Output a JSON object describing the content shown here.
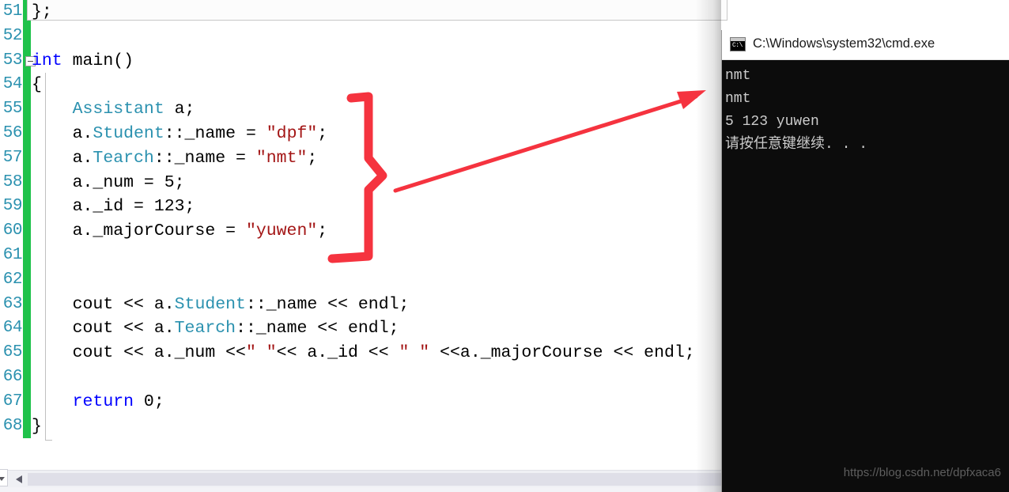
{
  "editor": {
    "name": "visual-studio-code-editor",
    "first_line_number": 51,
    "lines": [
      {
        "n": "51",
        "kind": "collapsed-end",
        "text": "};"
      },
      {
        "n": "52",
        "kind": "blank",
        "text": ""
      },
      {
        "n": "53",
        "kind": "fold",
        "text": "int main()"
      },
      {
        "n": "54",
        "kind": "code",
        "text": "{"
      },
      {
        "n": "55",
        "kind": "code",
        "text": "    Assistant a;"
      },
      {
        "n": "56",
        "kind": "code",
        "text": "    a.Student::_name = \"dpf\";"
      },
      {
        "n": "57",
        "kind": "code",
        "text": "    a.Tearch::_name = \"nmt\";"
      },
      {
        "n": "58",
        "kind": "code",
        "text": "    a._num = 5;"
      },
      {
        "n": "59",
        "kind": "code",
        "text": "    a._id = 123;"
      },
      {
        "n": "60",
        "kind": "code",
        "text": "    a._majorCourse = \"yuwen\";"
      },
      {
        "n": "61",
        "kind": "blank",
        "text": ""
      },
      {
        "n": "62",
        "kind": "blank",
        "text": ""
      },
      {
        "n": "63",
        "kind": "code",
        "text": "    cout << a.Student::_name << endl;"
      },
      {
        "n": "64",
        "kind": "code",
        "text": "    cout << a.Tearch::_name << endl;"
      },
      {
        "n": "65",
        "kind": "code",
        "text": "    cout << a._num <<\" \"<< a._id << \" \" <<a._majorCourse << endl;"
      },
      {
        "n": "66",
        "kind": "blank",
        "text": ""
      },
      {
        "n": "67",
        "kind": "code",
        "text": "    return 0;"
      },
      {
        "n": "68",
        "kind": "code",
        "text": "}"
      }
    ],
    "line_numbers": [
      "51",
      "52",
      "53",
      "54",
      "55",
      "56",
      "57",
      "58",
      "59",
      "60",
      "61",
      "62",
      "63",
      "64",
      "65",
      "66",
      "67",
      "68"
    ],
    "displayed_line_numbers": [
      "51",
      "52",
      "53",
      "54",
      "55",
      "56",
      "57",
      "58",
      "59",
      "60",
      "61",
      "62",
      "63",
      "64",
      "65",
      "66",
      "67",
      "68"
    ],
    "tokens": {
      "line51": [
        {
          "t": "};",
          "c": "plain"
        }
      ],
      "line53": [
        {
          "t": "int",
          "c": "kw"
        },
        {
          "t": " main()",
          "c": "plain"
        }
      ],
      "line54": [
        {
          "t": "{",
          "c": "plain"
        }
      ],
      "line55": [
        {
          "t": "    ",
          "c": "plain"
        },
        {
          "t": "Assistant",
          "c": "type"
        },
        {
          "t": " a;",
          "c": "plain"
        }
      ],
      "line56": [
        {
          "t": "    a.",
          "c": "plain"
        },
        {
          "t": "Student",
          "c": "type"
        },
        {
          "t": "::_name = ",
          "c": "plain"
        },
        {
          "t": "\"dpf\"",
          "c": "str"
        },
        {
          "t": ";",
          "c": "plain"
        }
      ],
      "line57": [
        {
          "t": "    a.",
          "c": "plain"
        },
        {
          "t": "Tearch",
          "c": "type"
        },
        {
          "t": "::_name = ",
          "c": "plain"
        },
        {
          "t": "\"nmt\"",
          "c": "str"
        },
        {
          "t": ";",
          "c": "plain"
        }
      ],
      "line58": [
        {
          "t": "    a._num = 5;",
          "c": "plain"
        }
      ],
      "line59": [
        {
          "t": "    a._id = 123;",
          "c": "plain"
        }
      ],
      "line60": [
        {
          "t": "    a._majorCourse = ",
          "c": "plain"
        },
        {
          "t": "\"yuwen\"",
          "c": "str"
        },
        {
          "t": ";",
          "c": "plain"
        }
      ],
      "line63": [
        {
          "t": "    cout << a.",
          "c": "plain"
        },
        {
          "t": "Student",
          "c": "type"
        },
        {
          "t": "::_name << endl;",
          "c": "plain"
        }
      ],
      "line64": [
        {
          "t": "    cout << a.",
          "c": "plain"
        },
        {
          "t": "Tearch",
          "c": "type"
        },
        {
          "t": "::_name << endl;",
          "c": "plain"
        }
      ],
      "line65": [
        {
          "t": "    cout << a._num <<",
          "c": "plain"
        },
        {
          "t": "\" \"",
          "c": "str"
        },
        {
          "t": "<< a._id << ",
          "c": "plain"
        },
        {
          "t": "\" \"",
          "c": "str"
        },
        {
          "t": " <<a._majorCourse << endl;",
          "c": "plain"
        }
      ],
      "line67": [
        {
          "t": "    ",
          "c": "plain"
        },
        {
          "t": "return",
          "c": "kw"
        },
        {
          "t": " 0;",
          "c": "plain"
        }
      ],
      "line68": [
        {
          "t": "}",
          "c": "plain"
        }
      ]
    },
    "scrollbar": {
      "left_arrow_icon": "triangle-left-icon",
      "dropdown_icon": "chevron-down-icon"
    }
  },
  "console": {
    "icon": "cmd-exe-icon",
    "icon_text": "C:\\",
    "title": "C:\\Windows\\system32\\cmd.exe",
    "output": [
      "nmt",
      "nmt",
      "5 123 yuwen",
      "请按任意键继续. . ."
    ],
    "watermark": "https://blog.csdn.net/dpfxaca6"
  },
  "annotations": {
    "brace": {
      "name": "red-curly-brace-annotation",
      "covers_lines": [
        "55",
        "56",
        "57",
        "58",
        "59",
        "60"
      ]
    },
    "arrow": {
      "name": "red-arrow-annotation",
      "points_from": "code-block",
      "points_to": "console-output"
    },
    "color": "#F5333F"
  },
  "colors": {
    "keyword": "#0000FF",
    "type": "#2B91AF",
    "string": "#A31515",
    "line_number": "#2B91AF",
    "change_bar": "#1FC24A",
    "annotation_red": "#F5333F",
    "console_bg": "#0C0C0C",
    "console_text": "#CCCCCC",
    "editor_bg": "#FFFFFF"
  }
}
